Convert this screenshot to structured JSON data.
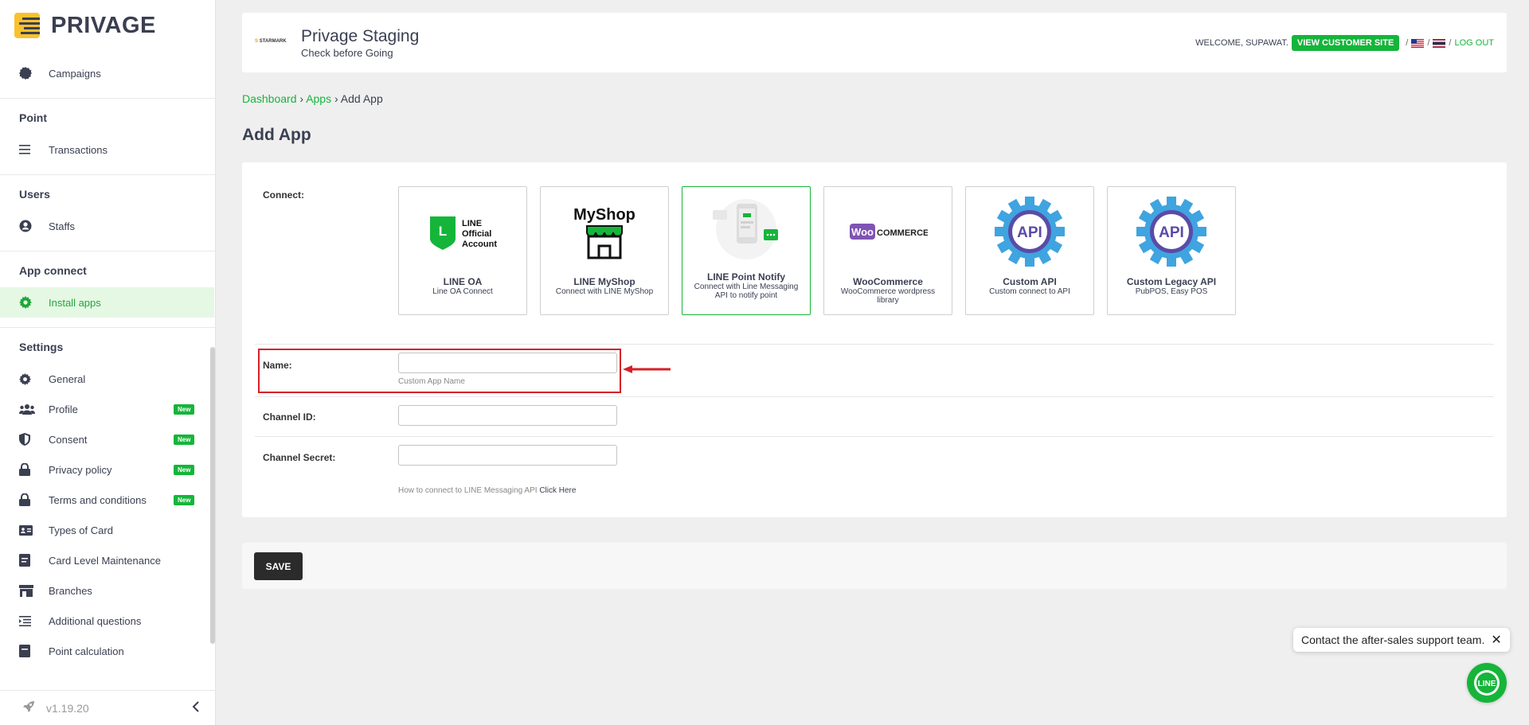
{
  "brand": {
    "name": "PRIVAGE"
  },
  "sidebar": {
    "items_top": [
      {
        "label": "Campaigns",
        "icon": "badge-icon"
      }
    ],
    "groups": [
      {
        "title": "Point",
        "items": [
          {
            "label": "Transactions",
            "icon": "list-icon"
          }
        ]
      },
      {
        "title": "Users",
        "items": [
          {
            "label": "Staffs",
            "icon": "user-circle-icon"
          }
        ]
      },
      {
        "title": "App connect",
        "items": [
          {
            "label": "Install apps",
            "icon": "gear-icon",
            "active": true
          }
        ]
      },
      {
        "title": "Settings",
        "items": [
          {
            "label": "General",
            "icon": "gear-icon"
          },
          {
            "label": "Profile",
            "icon": "users-icon",
            "badge": "New"
          },
          {
            "label": "Consent",
            "icon": "shield-icon",
            "badge": "New"
          },
          {
            "label": "Privacy policy",
            "icon": "lock-icon",
            "badge": "New"
          },
          {
            "label": "Terms and conditions",
            "icon": "lock-icon",
            "badge": "New"
          },
          {
            "label": "Types of Card",
            "icon": "id-card-icon"
          },
          {
            "label": "Card Level Maintenance",
            "icon": "document-icon"
          },
          {
            "label": "Branches",
            "icon": "store-icon"
          },
          {
            "label": "Additional questions",
            "icon": "list-indent-icon"
          },
          {
            "label": "Point calculation",
            "icon": "document-icon"
          }
        ]
      }
    ],
    "version": "v1.19.20"
  },
  "header": {
    "store_logo": "STARMARK",
    "store_name": "Privage Staging",
    "store_sub": "Check before Going",
    "welcome": "WELCOME, SUPAWAT.",
    "view_site": "VIEW CUSTOMER SITE",
    "separator": "/",
    "logout": "LOG OUT"
  },
  "breadcrumb": {
    "dashboard": "Dashboard",
    "apps": "Apps",
    "current": "Add App",
    "sep": "›"
  },
  "page_title": "Add App",
  "form": {
    "connect_label": "Connect:",
    "apps": [
      {
        "title": "LINE OA",
        "desc": "Line OA Connect"
      },
      {
        "title": "LINE MyShop",
        "desc": "Connect with LINE MyShop"
      },
      {
        "title": "LINE Point Notify",
        "desc": "Connect with Line Messaging API to notify point",
        "selected": true
      },
      {
        "title": "WooCommerce",
        "desc": "WooCommerce wordpress library"
      },
      {
        "title": "Custom API",
        "desc": "Custom connect to API"
      },
      {
        "title": "Custom Legacy API",
        "desc": "PubPOS, Easy POS"
      }
    ],
    "logo_text": {
      "line_oa_l": "L",
      "line_oa_line1": "LINE",
      "line_oa_line2": "Official",
      "line_oa_line3": "Account",
      "myshop": "MyShop",
      "woo": "Woo",
      "woo_commerce": "COMMERCE",
      "api": "API"
    },
    "name_label": "Name:",
    "name_value": "",
    "name_help": "Custom App Name",
    "channel_id_label": "Channel ID:",
    "channel_id_value": "",
    "channel_secret_label": "Channel Secret:",
    "channel_secret_value": "",
    "howto_text": "How to connect to LINE Messaging API",
    "howto_link": "Click Here"
  },
  "save_label": "SAVE",
  "support": {
    "text": "Contact the after-sales support team.",
    "close": "✕",
    "line_label": "LINE"
  },
  "colors": {
    "accent": "#15b53a",
    "highlight": "#d61f26",
    "dark": "#3a3f51",
    "brand_yellow": "#f9c12e"
  }
}
